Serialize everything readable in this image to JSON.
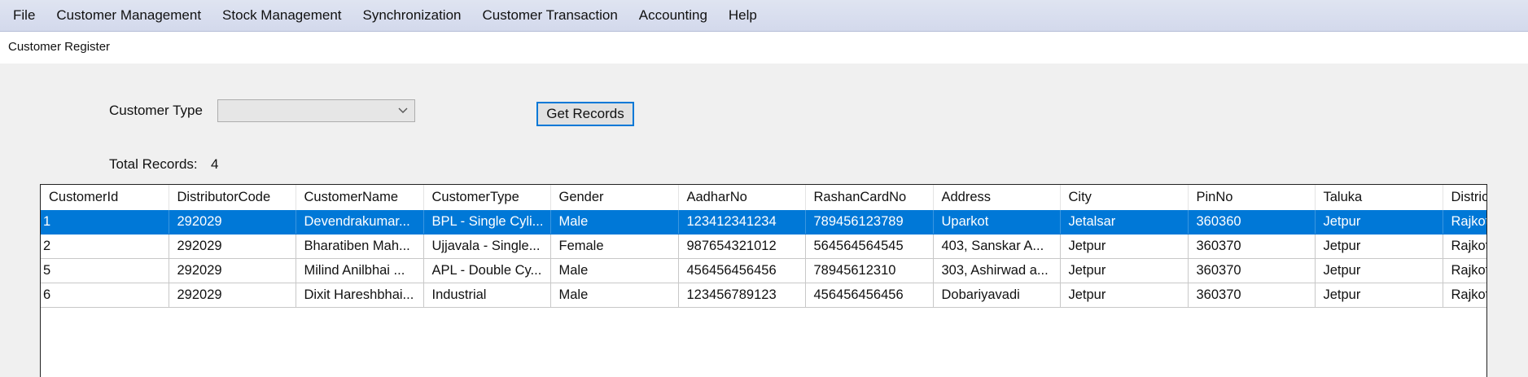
{
  "menu": [
    "File",
    "Customer Management",
    "Stock Management",
    "Synchronization",
    "Customer Transaction",
    "Accounting",
    "Help"
  ],
  "window_title": "Customer Register",
  "filter": {
    "customer_type_label": "Customer Type",
    "customer_type_value": "",
    "get_records_label": "Get Records",
    "total_records_label": "Total Records:",
    "total_records_value": "4"
  },
  "grid": {
    "columns": [
      "CustomerId",
      "DistributorCode",
      "CustomerName",
      "CustomerType",
      "Gender",
      "AadharNo",
      "RashanCardNo",
      "Address",
      "City",
      "PinNo",
      "Taluka",
      "District"
    ],
    "rows": [
      [
        "1",
        "292029",
        "Devendrakumar...",
        "BPL - Single Cyli...",
        "Male",
        "123412341234",
        "789456123789",
        "Uparkot",
        "Jetalsar",
        "360360",
        "Jetpur",
        "Rajkot"
      ],
      [
        "2",
        "292029",
        "Bharatiben Mah...",
        "Ujjavala - Single...",
        "Female",
        "987654321012",
        "564564564545",
        "403, Sanskar A...",
        "Jetpur",
        "360370",
        "Jetpur",
        "Rajkot"
      ],
      [
        "5",
        "292029",
        "Milind Anilbhai ...",
        "APL - Double Cy...",
        "Male",
        "456456456456",
        "78945612310",
        "303, Ashirwad a...",
        "Jetpur",
        "360370",
        "Jetpur",
        "Rajkot"
      ],
      [
        "6",
        "292029",
        "Dixit Hareshbhai...",
        "Industrial",
        "Male",
        "123456789123",
        "456456456456",
        "Dobariyavadi",
        "Jetpur",
        "360370",
        "Jetpur",
        "Rajkot"
      ]
    ],
    "selected_row": 0
  },
  "colors": {
    "selection": "#0078d7",
    "menubar": "#d8deef"
  }
}
